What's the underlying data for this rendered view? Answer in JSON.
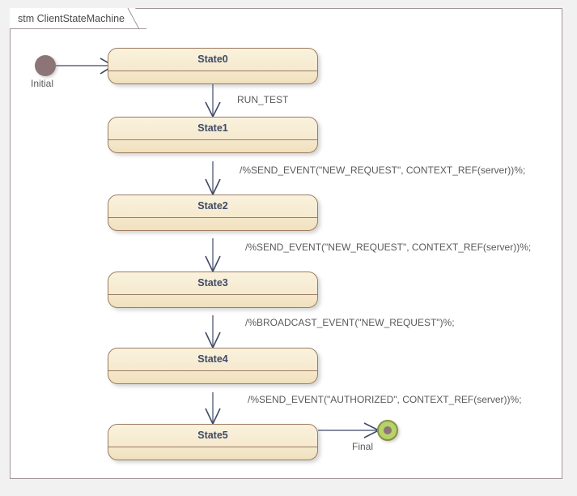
{
  "frame": {
    "title": "stm ClientStateMachine",
    "border_color": "#a39497",
    "background": "#ffffff"
  },
  "page": {
    "background": "#f1f1f1"
  },
  "palette": {
    "state_fill": "#f6ead0",
    "state_border": "#9c7b62",
    "state_title_color": "#3f4a66",
    "edge_color": "#5b6780",
    "label_color": "#5a5a5a",
    "initial_fill": "#8d7577",
    "final_fill": "#b5d36a",
    "final_border": "#8a8f3e",
    "final_dot": "#8d7577"
  },
  "nodes": {
    "initial": {
      "caption": "Initial",
      "type": "initial-pseudostate"
    },
    "final": {
      "caption": "Final",
      "type": "final-state"
    },
    "states": [
      {
        "name": "State0"
      },
      {
        "name": "State1"
      },
      {
        "name": "State2"
      },
      {
        "name": "State3"
      },
      {
        "name": "State4"
      },
      {
        "name": "State5"
      }
    ]
  },
  "transitions": [
    {
      "from": "Initial",
      "to": "State0",
      "label": ""
    },
    {
      "from": "State0",
      "to": "State1",
      "label": "RUN_TEST"
    },
    {
      "from": "State1",
      "to": "State2",
      "label": "/%SEND_EVENT(\"NEW_REQUEST\", CONTEXT_REF(server))%;"
    },
    {
      "from": "State2",
      "to": "State3",
      "label": "/%SEND_EVENT(\"NEW_REQUEST\", CONTEXT_REF(server))%;"
    },
    {
      "from": "State3",
      "to": "State4",
      "label": "/%BROADCAST_EVENT(\"NEW_REQUEST\")%;"
    },
    {
      "from": "State4",
      "to": "State5",
      "label": "/%SEND_EVENT(\"AUTHORIZED\", CONTEXT_REF(server))%;"
    },
    {
      "from": "State5",
      "to": "Final",
      "label": ""
    }
  ]
}
